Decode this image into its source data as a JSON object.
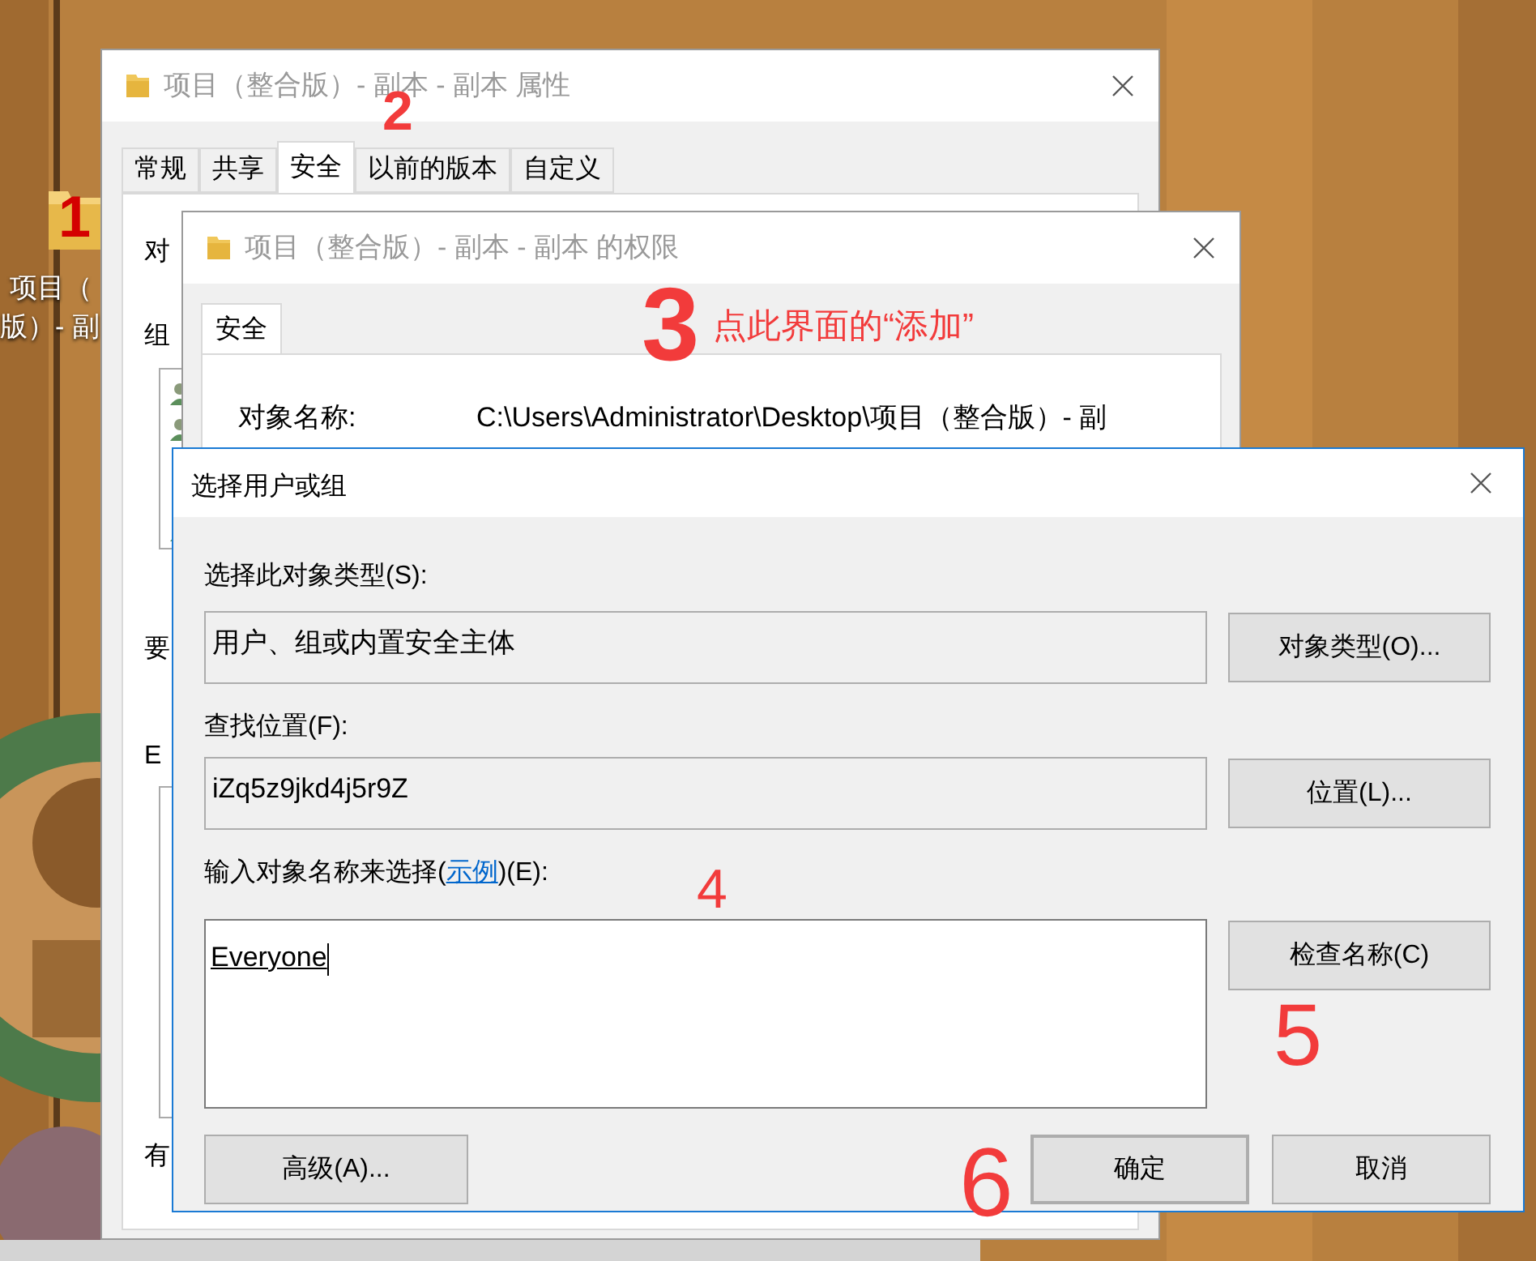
{
  "desktop_icon": {
    "label_lines": [
      "项目（",
      "版）- 副"
    ]
  },
  "properties_window": {
    "title": "项目（整合版）- 副本 - 副本 属性",
    "tabs": [
      {
        "label": "常规",
        "selected": false
      },
      {
        "label": "共享",
        "selected": false
      },
      {
        "label": "安全",
        "selected": true
      },
      {
        "label": "以前的版本",
        "selected": false
      },
      {
        "label": "自定义",
        "selected": false
      }
    ],
    "visible_fragments": [
      "对",
      "组",
      "要",
      "E",
      "有"
    ]
  },
  "permissions_window": {
    "title": "项目（整合版）- 副本 - 副本 的权限",
    "tabs": [
      {
        "label": "安全",
        "selected": true
      }
    ],
    "object_name_label": "对象名称:",
    "object_name": "C:\\Users\\Administrator\\Desktop\\项目（整合版）- 副"
  },
  "select_dialog": {
    "title": "选择用户或组",
    "object_type_label": "选择此对象类型(S):",
    "object_type": "用户、组或内置安全主体",
    "object_type_button": "对象类型(O)...",
    "location_label": "查找位置(F):",
    "location": "iZq5z9jkd4j5r9Z",
    "location_button": "位置(L)...",
    "names_label": "输入对象名称来选择(",
    "names_link": "示例",
    "names_label_end": ")(E):",
    "names_value": "Everyone",
    "check_names_button": "检查名称(C)",
    "advanced_button": "高级(A)...",
    "ok_button": {
      "label": "确定",
      "focused": true
    },
    "cancel_button": "取消"
  },
  "annotations": [
    {
      "text": "1"
    },
    {
      "text": "2"
    },
    {
      "text": "3"
    },
    {
      "text": "点此界面的“添加”"
    },
    {
      "text": "4"
    },
    {
      "text": "5"
    },
    {
      "text": "6"
    }
  ]
}
